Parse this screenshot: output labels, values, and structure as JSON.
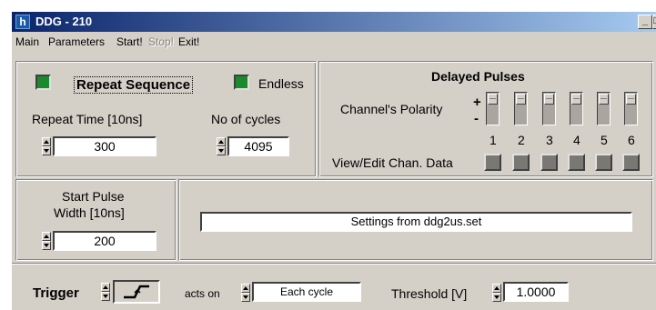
{
  "window": {
    "title": "DDG - 210"
  },
  "menu": {
    "items": [
      {
        "label": "Main",
        "enabled": true
      },
      {
        "label": "Parameters",
        "enabled": true
      },
      {
        "label": "Start!",
        "enabled": true
      },
      {
        "label": "Stop!",
        "enabled": false
      },
      {
        "label": "Exit!",
        "enabled": true
      }
    ]
  },
  "sequence": {
    "repeat_label": "Repeat Sequence",
    "endless_label": "Endless",
    "repeat_time_label": "Repeat Time [10ns]",
    "repeat_time_value": "300",
    "cycles_label": "No of cycles",
    "cycles_value": "4095"
  },
  "delayed": {
    "title": "Delayed Pulses",
    "polarity_label": "Channel's Polarity",
    "plus": "+",
    "minus": "-",
    "channels": [
      "1",
      "2",
      "3",
      "4",
      "5",
      "6"
    ],
    "view_edit_label": "View/Edit Chan. Data"
  },
  "start_pulse": {
    "label_line1": "Start Pulse",
    "label_line2": "Width [10ns]",
    "value": "200"
  },
  "settings": {
    "text": "Settings from ddg2us.set"
  },
  "trigger": {
    "label": "Trigger",
    "acts_on_label": "acts on",
    "acts_on_value": "Each cycle",
    "threshold_label": "Threshold [V]",
    "threshold_value": "1.0000"
  },
  "colors": {
    "led_on": "#1b8a2c",
    "titlebar": "#0a246a",
    "face": "#d4d0c8"
  }
}
